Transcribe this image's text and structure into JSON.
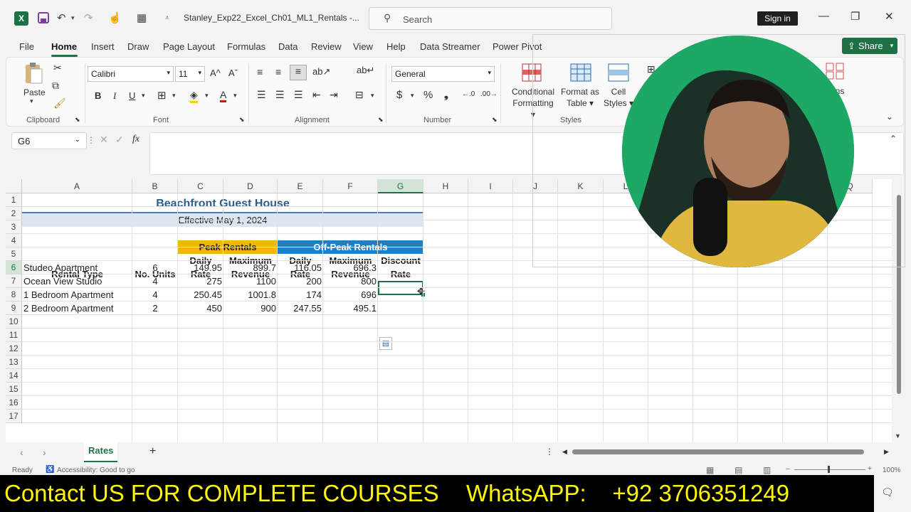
{
  "titlebar": {
    "doc_title": "Stanley_Exp22_Excel_Ch01_ML1_Rentals  -...",
    "search_placeholder": "Search",
    "signin": "Sign in"
  },
  "menu": [
    "File",
    "Home",
    "Insert",
    "Draw",
    "Page Layout",
    "Formulas",
    "Data",
    "Review",
    "View",
    "Help",
    "Data Streamer",
    "Power Pivot"
  ],
  "share_label": "Share",
  "ribbon": {
    "clipboard_label": "Clipboard",
    "paste_label": "Paste",
    "font_label": "Font",
    "font_name": "Calibri",
    "font_size": "11",
    "alignment_label": "Alignment",
    "number_label": "Number",
    "number_format": "General",
    "styles_label": "Styles",
    "cond_fmt_1": "Conditional",
    "cond_fmt_2": "Formatting",
    "fmt_table_1": "Format as",
    "fmt_table_2": "Table",
    "cell_styles_1": "Cell",
    "cell_styles_2": "Styles",
    "addins_partial": "ins"
  },
  "formula_bar": {
    "name_box": "G6",
    "fx": "fx",
    "content": ""
  },
  "columns": [
    "A",
    "B",
    "C",
    "D",
    "E",
    "F",
    "G",
    "H",
    "I",
    "J",
    "K",
    "L",
    "M",
    "N",
    "O",
    "P",
    "Q"
  ],
  "rows": [
    "1",
    "2",
    "3",
    "4",
    "5",
    "6",
    "7",
    "8",
    "9",
    "10",
    "11",
    "12",
    "13",
    "14",
    "15",
    "16",
    "17"
  ],
  "sheet": {
    "title": "Beachfront Guest House",
    "subtitle": "Effective May 1, 2024",
    "peak_header": "Peak Rentals",
    "offpeak_header": "Off-Peak Rentals",
    "headers": {
      "rental_type": "Rental Type",
      "no_units": "No. Units",
      "daily_1": "Daily",
      "rate_1": "Rate",
      "max_1": "Maximum",
      "rev_1": "Revenue",
      "daily_2": "Daily",
      "rate_2": "Rate",
      "max_2": "Maximum",
      "rev_2": "Revenue",
      "discount": "Discount",
      "rate_3": "Rate"
    },
    "data": [
      {
        "type": "Studeo Apartment",
        "units": "6",
        "peak_rate": "149.95",
        "peak_rev": "899.7",
        "off_rate": "116.05",
        "off_rev": "696.3",
        "disc": ""
      },
      {
        "type": "Ocean View Studio",
        "units": "4",
        "peak_rate": "275",
        "peak_rev": "1100",
        "off_rate": "200",
        "off_rev": "800",
        "disc": ""
      },
      {
        "type": "1 Bedroom Apartment",
        "units": "4",
        "peak_rate": "250.45",
        "peak_rev": "1001.8",
        "off_rate": "174",
        "off_rev": "696",
        "disc": ""
      },
      {
        "type": "2 Bedroom Apartment",
        "units": "2",
        "peak_rate": "450",
        "peak_rev": "900",
        "off_rate": "247.55",
        "off_rev": "495.1",
        "disc": ""
      }
    ]
  },
  "sheet_tab": "Rates",
  "status": {
    "ready": "Ready",
    "accessibility": "Accessibility: Good to go",
    "zoom": "100%"
  },
  "banner": {
    "left": "Contact US FOR COMPLETE COURSES",
    "right": "WhatsAPP:    +92 3706351249"
  },
  "colors": {
    "excel_green": "#1e7145",
    "peak_fill": "#f2b705",
    "offpeak_fill": "#1f7fc4",
    "subtitle_fill": "#dde6f0",
    "title_text": "#2e5d8a"
  }
}
